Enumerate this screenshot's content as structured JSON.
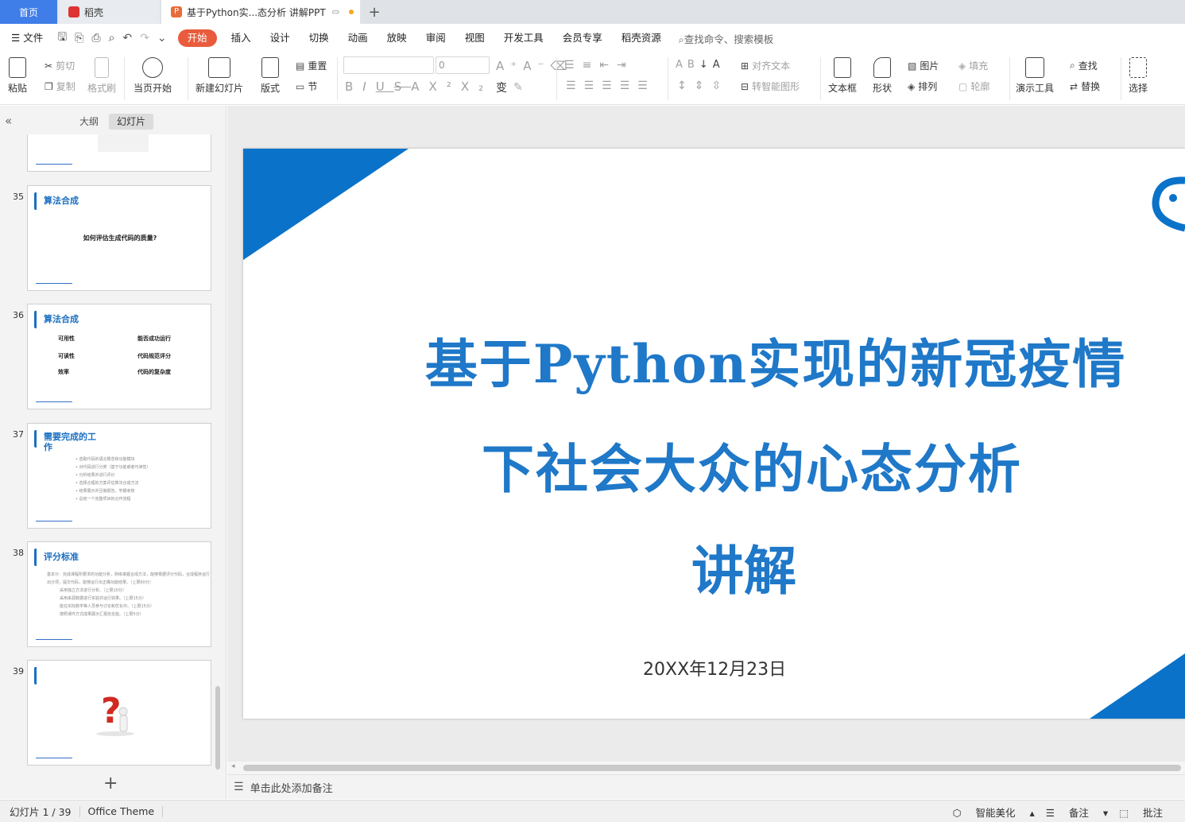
{
  "tabs": {
    "home": "首页",
    "docer": "稻壳",
    "document": "基于Python实...态分析 讲解PPT",
    "add": "+"
  },
  "menu": {
    "file": "文件",
    "items": [
      "开始",
      "插入",
      "设计",
      "切换",
      "动画",
      "放映",
      "审阅",
      "视图",
      "开发工具",
      "会员专享",
      "稻壳资源"
    ],
    "search": "查找命令、搜索模板"
  },
  "ribbon": {
    "paste": "粘贴",
    "cut": "剪切",
    "copy": "复制",
    "format_painter": "格式刷",
    "play_from_current": "当页开始",
    "new_slide": "新建幻灯片",
    "layout": "版式",
    "reset": "重置",
    "section": "节",
    "font_size": "0",
    "align_text": "对齐文本",
    "smart_shape": "转智能图形",
    "text_box": "文本框",
    "shape": "形状",
    "picture": "图片",
    "arrange": "排列",
    "fill": "填充",
    "outline": "轮廓",
    "presentation_tools": "演示工具",
    "find": "查找",
    "replace": "替换",
    "select": "选择"
  },
  "panel": {
    "outline_tab": "大纲",
    "slides_tab": "幻灯片",
    "slides": [
      {
        "num": "35",
        "title": "算法合成",
        "body": "如何评估生成代码的质量?"
      },
      {
        "num": "36",
        "title": "算法合成",
        "items": [
          "可用性",
          "能否成功运行",
          "可读性",
          "代码规范评分",
          "效率",
          "代码的复杂度"
        ]
      },
      {
        "num": "37",
        "title": "需要完成的工作",
        "bullets": [
          "•  选取代码的语言概念和功能模块",
          "•  对代码进行分类（基于功能或者可读性）",
          "•  分析结果并进行评价",
          "•  选择合理的方案评估算法合成方法",
          "•  结果展示并且做报告，学期考核",
          "•  总结一个完整项目的合作流程"
        ]
      },
      {
        "num": "38",
        "title": "评分标准",
        "para": [
          "基本分：完成课程所要求的功能分析，熟练掌握合成方法，能够根据评分代码，合成程序运行",
          "出分项，提交代码，能够运行出正确功能结果。（上限60分）",
          "采用独立方法进行分析。（上限10分）",
          "采用来源数据进行实验并运行效果。（上限15分）",
          "能在实际数学等人员参与讨论和优化中。（上限15分）",
          "按照课件方式成果展示汇报完全能。（上限5分）"
        ]
      },
      {
        "num": "39"
      }
    ]
  },
  "slide": {
    "title_line1": "基于Python实现的新冠疫情",
    "title_line2": "下社会大众的心态分析",
    "title_line3": "讲解",
    "date": "20XX年12月23日"
  },
  "notes_placeholder": "单击此处添加备注",
  "status": {
    "slide_counter": "幻灯片 1 / 39",
    "theme": "Office Theme",
    "smart_beautify": "智能美化",
    "notes": "备注",
    "comments": "批注"
  },
  "colors": {
    "accent": "#e95b3c",
    "title_blue": "#1f78c8",
    "triangle_blue": "#0a72c9"
  }
}
